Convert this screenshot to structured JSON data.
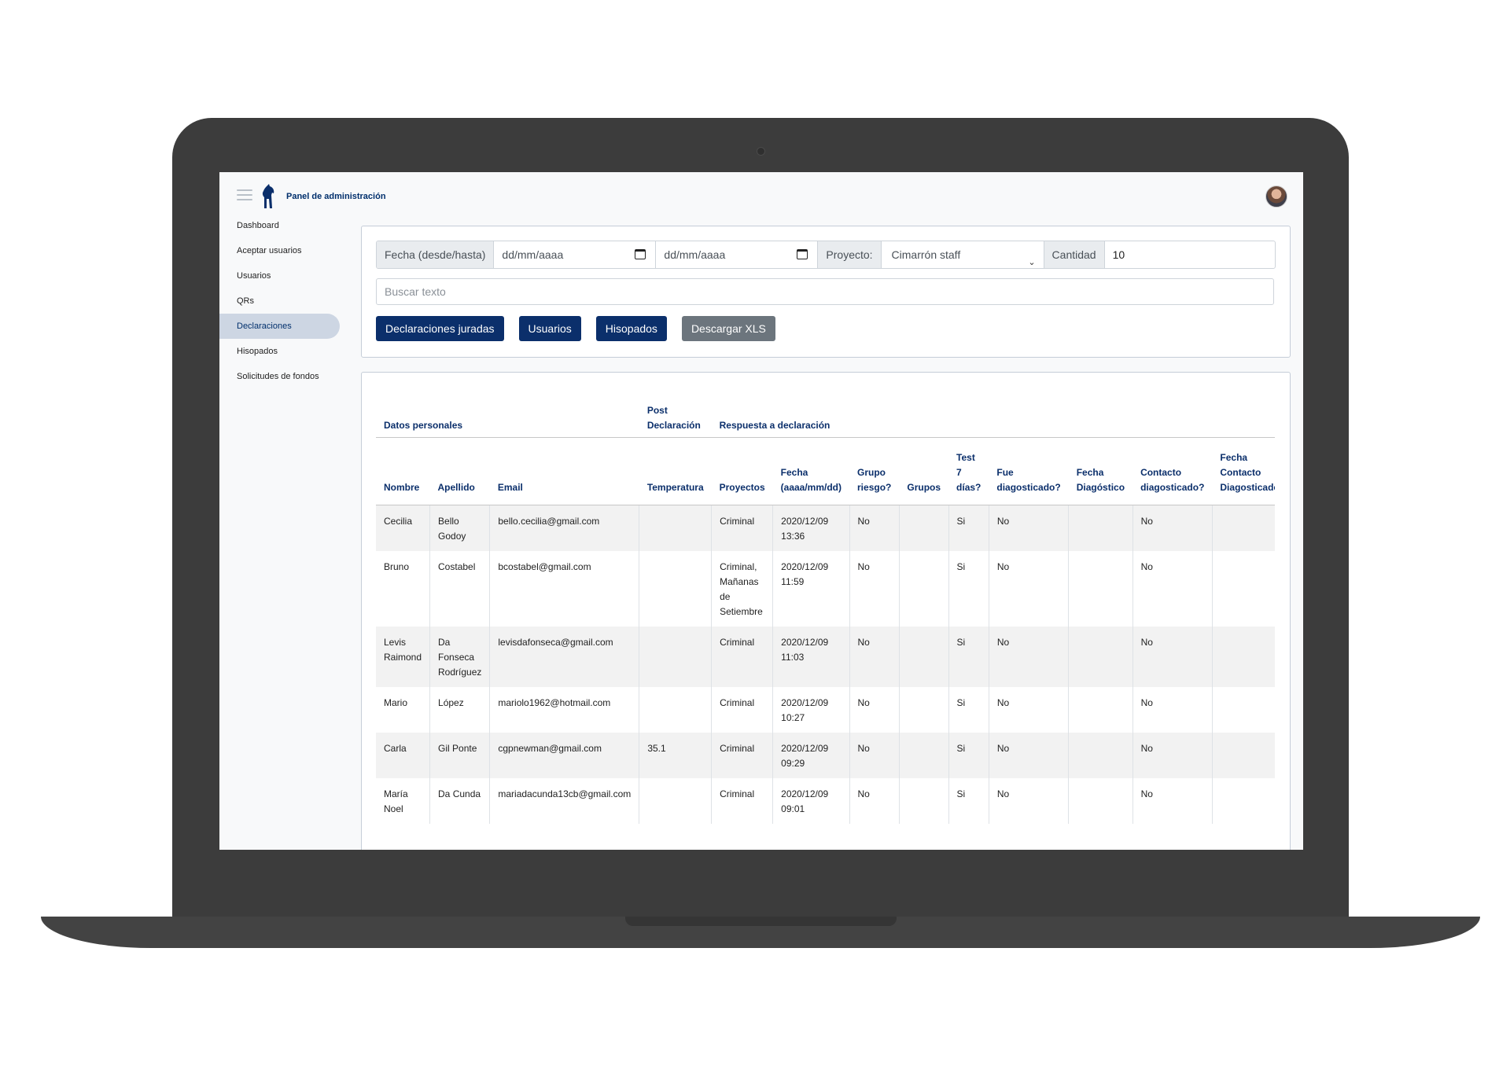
{
  "header": {
    "brand": "Panel de administración"
  },
  "sidebar": {
    "items": [
      {
        "label": "Dashboard"
      },
      {
        "label": "Aceptar usuarios"
      },
      {
        "label": "Usuarios"
      },
      {
        "label": "QRs"
      },
      {
        "label": "Declaraciones",
        "active": true
      },
      {
        "label": "Hisopados"
      },
      {
        "label": "Solicitudes de fondos"
      }
    ]
  },
  "filters": {
    "date_label": "Fecha (desde/hasta)",
    "date_from": "dd/mm/aaaa",
    "date_to": "dd/mm/aaaa",
    "project_label": "Proyecto:",
    "project_value": "Cimarrón staff",
    "qty_label": "Cantidad",
    "qty_value": "10",
    "search_placeholder": "Buscar texto"
  },
  "buttons": {
    "declaraciones": "Declaraciones juradas",
    "usuarios": "Usuarios",
    "hisopados": "Hisopados",
    "descargar": "Descargar XLS"
  },
  "colors": {
    "accent": "#0b2f6b",
    "disabled": "#6c757d",
    "active_nav_bg": "#cdd6e3"
  },
  "table": {
    "groups": [
      "Datos personales",
      "Post Declaración",
      "Respuesta a declaración"
    ],
    "columns": [
      "Nombre",
      "Apellido",
      "Email",
      "Temperatura",
      "Proyectos",
      "Fecha (aaaa/mm/dd)",
      "Grupo riesgo?",
      "Grupos",
      "Test 7 días?",
      "Fue diagosticado?",
      "Fecha Diagóstico",
      "Contacto diagosticado?",
      "Fecha Contacto Diagosticado"
    ],
    "rows": [
      [
        "Cecilia",
        "Bello Godoy",
        "bello.cecilia@gmail.com",
        "",
        "Criminal",
        "2020/12/09 13:36",
        "No",
        "",
        "Si",
        "No",
        "",
        "No",
        ""
      ],
      [
        "Bruno",
        "Costabel",
        "bcostabel@gmail.com",
        "",
        "Criminal, Mañanas de Setiembre",
        "2020/12/09 11:59",
        "No",
        "",
        "Si",
        "No",
        "",
        "No",
        ""
      ],
      [
        "Levis Raimond",
        "Da Fonseca Rodríguez",
        "levisdafonseca@gmail.com",
        "",
        "Criminal",
        "2020/12/09 11:03",
        "No",
        "",
        "Si",
        "No",
        "",
        "No",
        ""
      ],
      [
        "Mario",
        "López",
        "mariolo1962@hotmail.com",
        "",
        "Criminal",
        "2020/12/09 10:27",
        "No",
        "",
        "Si",
        "No",
        "",
        "No",
        ""
      ],
      [
        "Carla",
        "Gil Ponte",
        "cgpnewman@gmail.com",
        "35.1",
        "Criminal",
        "2020/12/09 09:29",
        "No",
        "",
        "Si",
        "No",
        "",
        "No",
        ""
      ],
      [
        "María Noel",
        "Da Cunda",
        "mariadacunda13cb@gmail.com",
        "",
        "Criminal",
        "2020/12/09 09:01",
        "No",
        "",
        "Si",
        "No",
        "",
        "No",
        ""
      ]
    ]
  }
}
